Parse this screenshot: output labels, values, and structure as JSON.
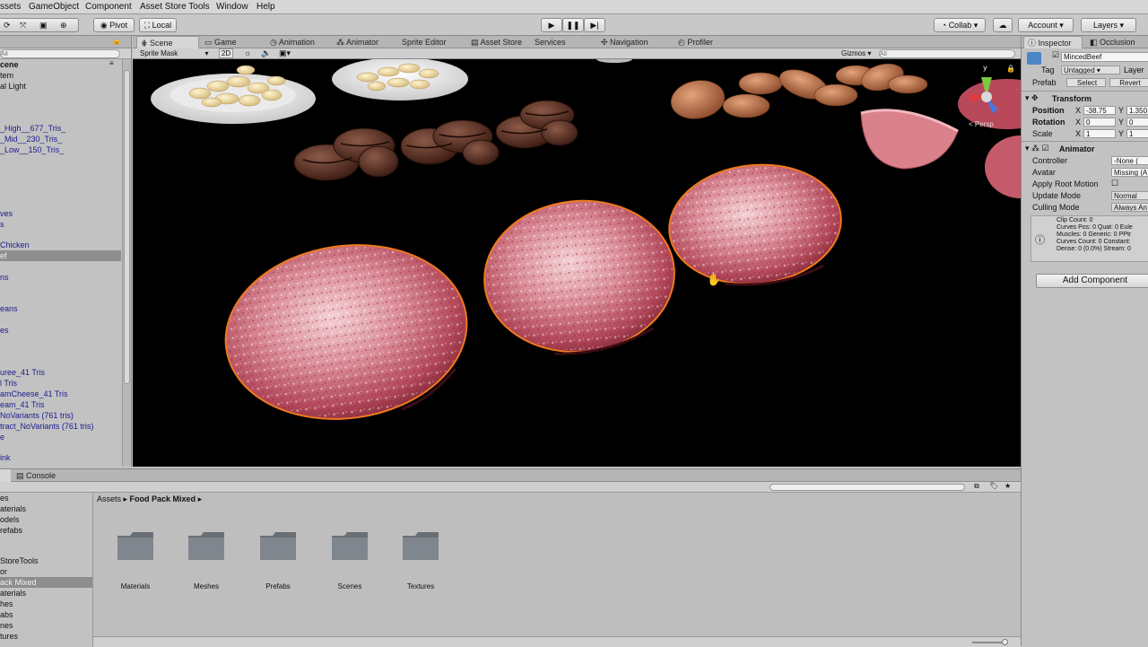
{
  "menu": [
    "ssets",
    "GameObject",
    "Component",
    "Asset Store Tools",
    "Window",
    "Help"
  ],
  "toolbar": {
    "pivot": "Pivot",
    "local": "Local",
    "collab": "Collab ▾",
    "account": "Account",
    "layers": "Layers"
  },
  "scene_tabs": [
    "Scene",
    "Game",
    "Animation",
    "Animator",
    "Sprite Editor",
    "Asset Store",
    "Services",
    "Navigation",
    "Profiler"
  ],
  "scene_sub": {
    "sprite_mask": "Sprite Mask",
    "mode_2d": "2D",
    "gizmos": "Gizmos ▾",
    "search_placeholder": "All",
    "persp": "< Persp"
  },
  "hierarchy": {
    "search_placeholder": "All",
    "items": [
      {
        "label": "cene"
      },
      {
        "label": "tem"
      },
      {
        "label": "al Light"
      },
      {
        "label": "_High__677_Tris_"
      },
      {
        "label": "_Mid__230_Tris_"
      },
      {
        "label": "_Low__150_Tris_"
      },
      {
        "label": "ves"
      },
      {
        "label": "s"
      },
      {
        "label": "Chicken"
      },
      {
        "label": "ef"
      },
      {
        "label": "ns"
      },
      {
        "label": "eans"
      },
      {
        "label": "es"
      },
      {
        "label": "uree_41 Tris"
      },
      {
        "label": "l Tris"
      },
      {
        "label": "amCheese_41 Tris"
      },
      {
        "label": "eam_41 Tris"
      },
      {
        "label": "NoVariants (761 tris)"
      },
      {
        "label": "tract_NoVariants (761 tris)"
      },
      {
        "label": "e"
      },
      {
        "label": "ink"
      }
    ]
  },
  "inspector": {
    "tabs": [
      "Inspector",
      "Occlusion"
    ],
    "object_name": "MincedBeef",
    "tag_label": "Tag",
    "tag_value": "Untagged",
    "layer_label": "Layer",
    "prefab_label": "Prefab",
    "prefab_select": "Select",
    "prefab_revert": "Revert",
    "transform_title": "Transform",
    "position_label": "Position",
    "position_x": "-38.75",
    "position_y": "1.350",
    "rotation_label": "Rotation",
    "rotation_x": "0",
    "rotation_y": "0",
    "scale_label": "Scale",
    "scale_x": "1",
    "scale_y": "1",
    "animator_title": "Animator",
    "controller_label": "Controller",
    "controller_value": "None (",
    "avatar_label": "Avatar",
    "avatar_value": "Missing (A",
    "apply_root_motion": "Apply Root Motion",
    "update_mode_label": "Update Mode",
    "update_mode_value": "Normal",
    "culling_mode_label": "Culling Mode",
    "culling_mode_value": "Always An",
    "info": [
      "Clip Count: 0",
      "Curves Pos: 0 Quat: 0 Eule",
      "Muscles: 0 Generic: 0 PPtr",
      "Curves Count: 0 Constant:",
      "Dense: 0 (0.0%) Stream: 0"
    ],
    "add_component": "Add Component"
  },
  "console_tab": "Console",
  "project": {
    "breadcrumb_root": "Assets",
    "breadcrumb_current": "Food Pack Mixed",
    "tree": [
      {
        "label": "es"
      },
      {
        "label": "aterials"
      },
      {
        "label": "odels"
      },
      {
        "label": "refabs"
      },
      {
        "label": "StoreTools"
      },
      {
        "label": "or"
      },
      {
        "label": "ack Mixed"
      },
      {
        "label": "aterials"
      },
      {
        "label": "hes"
      },
      {
        "label": "abs"
      },
      {
        "label": "nes"
      },
      {
        "label": "tures"
      }
    ],
    "folders": [
      "Materials",
      "Meshes",
      "Prefabs",
      "Scenes",
      "Textures"
    ]
  },
  "colors": {
    "selection_outline": "#f07a1e",
    "viewport_bg": "#000000",
    "panel_bg": "#c2c2c2",
    "hierarchy_link": "#1b1b8f"
  }
}
